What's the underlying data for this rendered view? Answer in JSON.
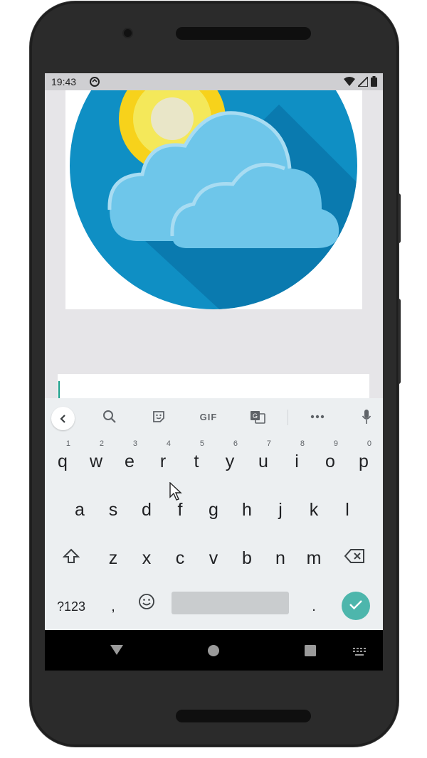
{
  "status_bar": {
    "time": "19:43"
  },
  "toolbar": {
    "icons": [
      "back-chevron-icon",
      "search-icon",
      "sticker-icon",
      "gif-icon",
      "translate-icon",
      "more-icon",
      "mic-icon"
    ],
    "gif_label": "GIF"
  },
  "keyboard": {
    "row1": [
      {
        "label": "q",
        "hint": "1"
      },
      {
        "label": "w",
        "hint": "2"
      },
      {
        "label": "e",
        "hint": "3"
      },
      {
        "label": "r",
        "hint": "4"
      },
      {
        "label": "t",
        "hint": "5"
      },
      {
        "label": "y",
        "hint": "6"
      },
      {
        "label": "u",
        "hint": "7"
      },
      {
        "label": "i",
        "hint": "8"
      },
      {
        "label": "o",
        "hint": "9"
      },
      {
        "label": "p",
        "hint": "0"
      }
    ],
    "row2": [
      "a",
      "s",
      "d",
      "f",
      "g",
      "h",
      "j",
      "k",
      "l"
    ],
    "row3": [
      "z",
      "x",
      "c",
      "v",
      "b",
      "n",
      "m"
    ],
    "symbols_label": "?123",
    "comma_label": ",",
    "period_label": "."
  },
  "colors": {
    "accent": "#4db6ac",
    "sky": "#0f8fc4",
    "cloud": "#6ec6ea",
    "sun": "#f7d21b"
  }
}
